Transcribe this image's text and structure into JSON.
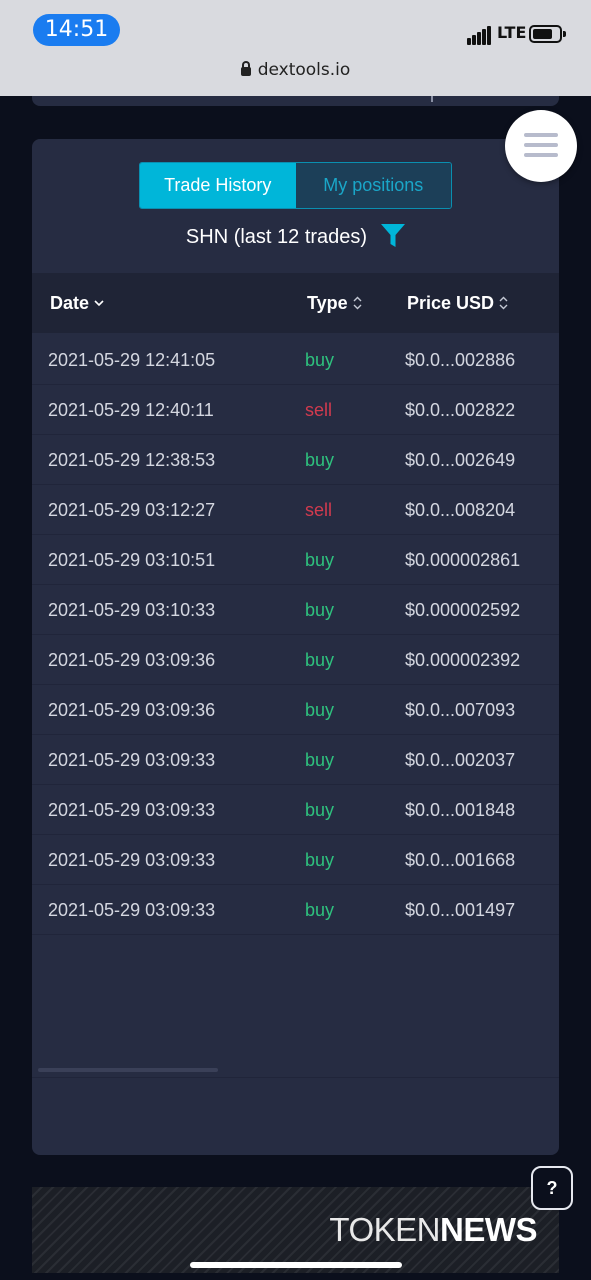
{
  "status_bar": {
    "time": "14:51",
    "network": "LTE",
    "url": "dextools.io"
  },
  "tabs": [
    {
      "label": "Trade History",
      "active": true
    },
    {
      "label": "My positions",
      "active": false
    }
  ],
  "subtitle": "SHN (last 12 trades)",
  "table": {
    "columns": [
      "Date",
      "Type",
      "Price USD"
    ],
    "rows": [
      {
        "date": "2021-05-29 12:41:05",
        "type": "buy",
        "price": "$0.0...002886"
      },
      {
        "date": "2021-05-29 12:40:11",
        "type": "sell",
        "price": "$0.0...002822"
      },
      {
        "date": "2021-05-29 12:38:53",
        "type": "buy",
        "price": "$0.0...002649"
      },
      {
        "date": "2021-05-29 03:12:27",
        "type": "sell",
        "price": "$0.0...008204"
      },
      {
        "date": "2021-05-29 03:10:51",
        "type": "buy",
        "price": "$0.000002861"
      },
      {
        "date": "2021-05-29 03:10:33",
        "type": "buy",
        "price": "$0.000002592"
      },
      {
        "date": "2021-05-29 03:09:36",
        "type": "buy",
        "price": "$0.000002392"
      },
      {
        "date": "2021-05-29 03:09:36",
        "type": "buy",
        "price": "$0.0...007093"
      },
      {
        "date": "2021-05-29 03:09:33",
        "type": "buy",
        "price": "$0.0...002037"
      },
      {
        "date": "2021-05-29 03:09:33",
        "type": "buy",
        "price": "$0.0...001848"
      },
      {
        "date": "2021-05-29 03:09:33",
        "type": "buy",
        "price": "$0.0...001668"
      },
      {
        "date": "2021-05-29 03:09:33",
        "type": "buy",
        "price": "$0.0...001497"
      }
    ]
  },
  "banner": {
    "word1": "TOKEN",
    "word2": "NEWS"
  },
  "help_label": "?",
  "colors": {
    "accent": "#00b6d9",
    "buy": "#2ec27e",
    "sell": "#d23a4e",
    "card": "#262c42"
  }
}
